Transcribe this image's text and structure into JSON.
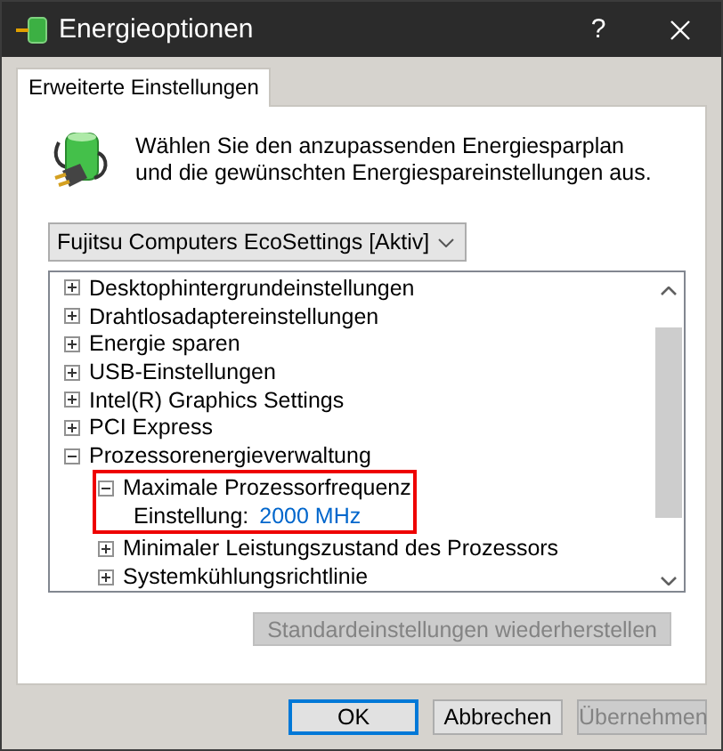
{
  "window": {
    "title": "Energieoptionen",
    "help_glyph": "?"
  },
  "tabs": [
    {
      "label": "Erweiterte Einstellungen",
      "selected": true
    }
  ],
  "intro": "Wählen Sie den anzupassenden Energiesparplan und die gewünschten Energiespareinstellungen aus.",
  "plan_select": {
    "value": "Fujitsu Computers EcoSettings [Aktiv]"
  },
  "tree": [
    {
      "label": "Desktophintergrundeinstellungen",
      "expanded": false
    },
    {
      "label": "Drahtlosadaptereinstellungen",
      "expanded": false
    },
    {
      "label": "Energie sparen",
      "expanded": false
    },
    {
      "label": "USB-Einstellungen",
      "expanded": false
    },
    {
      "label": "Intel(R) Graphics Settings",
      "expanded": false
    },
    {
      "label": "PCI Express",
      "expanded": false
    },
    {
      "label": "Prozessorenergieverwaltung",
      "expanded": true,
      "children": [
        {
          "label": "Maximale Prozessorfrequenz",
          "expanded": true,
          "highlighted": true,
          "setting": {
            "label": "Einstellung:",
            "value": "2000 MHz"
          }
        },
        {
          "label": "Minimaler Leistungszustand des Prozessors",
          "expanded": false
        },
        {
          "label": "Systemkühlungsrichtlinie",
          "expanded": false
        }
      ]
    }
  ],
  "restore_button": {
    "label": "Standardeinstellungen wiederherstellen",
    "disabled": true
  },
  "buttons": [
    {
      "label": "OK",
      "default": true,
      "disabled": false
    },
    {
      "label": "Abbrechen",
      "default": false,
      "disabled": false
    },
    {
      "label": "Übernehmen",
      "default": false,
      "disabled": true
    }
  ]
}
